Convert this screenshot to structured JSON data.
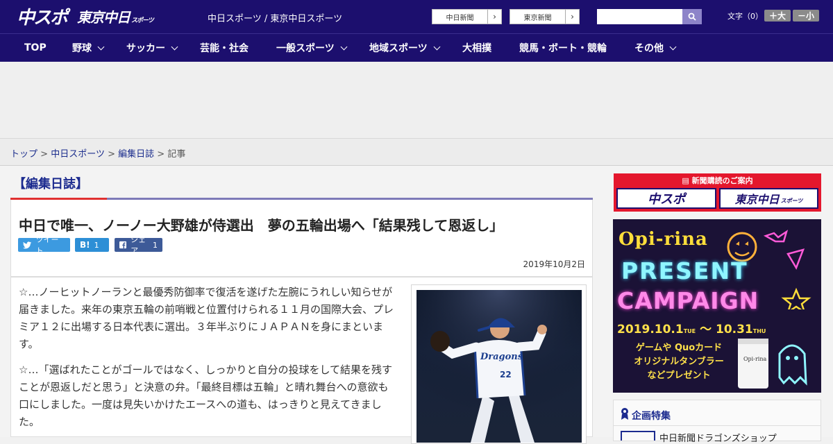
{
  "header": {
    "logo_primary": "中スポ",
    "logo_secondary": "東京中日",
    "logo_secondary_suffix": "スポーツ",
    "site_links": "中日スポーツ / 東京中日スポーツ",
    "paper_buttons": [
      {
        "label": "中日新聞",
        "arrow": "›"
      },
      {
        "label": "東京新聞",
        "arrow": "›"
      }
    ],
    "search_placeholder": "",
    "font_size_label": "文字（0）",
    "font_larger": "＋大",
    "font_smaller": "－小"
  },
  "nav": {
    "items": [
      {
        "label": "TOP",
        "dropdown": false
      },
      {
        "label": "野球",
        "dropdown": true
      },
      {
        "label": "サッカー",
        "dropdown": true
      },
      {
        "label": "芸能・社会",
        "dropdown": false
      },
      {
        "label": "一般スポーツ",
        "dropdown": true
      },
      {
        "label": "地域スポーツ",
        "dropdown": true
      },
      {
        "label": "大相撲",
        "dropdown": false
      },
      {
        "label": "競馬・ボート・競輪",
        "dropdown": false
      },
      {
        "label": "その他",
        "dropdown": true
      }
    ]
  },
  "breadcrumb": {
    "items": [
      "トップ",
      "中日スポーツ",
      "編集日誌",
      "記事"
    ],
    "separator": ">"
  },
  "section": {
    "title": "【編集日誌】"
  },
  "article": {
    "title": "中日で唯一、ノーノー大野雄が侍選出　夢の五輪出場へ「結果残して恩返し」",
    "share": {
      "tweet": "ツイート",
      "hatena_icon": "B!",
      "hatena_count": "1",
      "facebook_label": "シェア",
      "facebook_count": "1"
    },
    "date": "2019年10月2日",
    "paragraphs": [
      "☆…ノーヒットノーランと最優秀防御率で復活を遂げた左腕にうれしい知らせが届きました。来年の東京五輪の前哨戦と位置付けられる１１月の国際大会、プレミア１２に出場する日本代表に選出。３年半ぶりにＪＡＰＡＮを身にまといます。",
      "☆…「選ばれたことがゴールではなく、しっかりと自分の投球をして結果を残すことが恩返しだと思う」と決意の弁。「最終目標は五輪」と晴れ舞台への意欲も口にしました。一度は見失いかけたエースへの道も、はっきりと見えてきました。"
    ],
    "photo_jersey_text": "Dragons",
    "photo_jersey_number": "22"
  },
  "sidebar": {
    "subscription": {
      "caption": "新聞購読のご案内",
      "buttons": [
        "中スポ",
        "東京中日"
      ],
      "button2_suffix": "スポーツ"
    },
    "campaign": {
      "brand": "Opi-rina",
      "line1": "PRESENT",
      "line2": "CAMPAIGN",
      "dates": "2019.10.1",
      "dates_day1": "TUE",
      "dates_sep": "〜",
      "dates_end": "10.31",
      "dates_day2": "THU",
      "gift_lines": [
        "ゲームや Quoカード",
        "オリジナルタンブラー",
        "などプレゼント"
      ],
      "tumbler_label": "Opi-rina"
    },
    "feature": {
      "title": "企画特集",
      "first_item": "中日新聞ドラゴンズショップ"
    }
  },
  "colors": {
    "brand_navy": "#1c0f6e",
    "accent_red": "#e4172d",
    "link_blue": "#1a2c8c"
  }
}
